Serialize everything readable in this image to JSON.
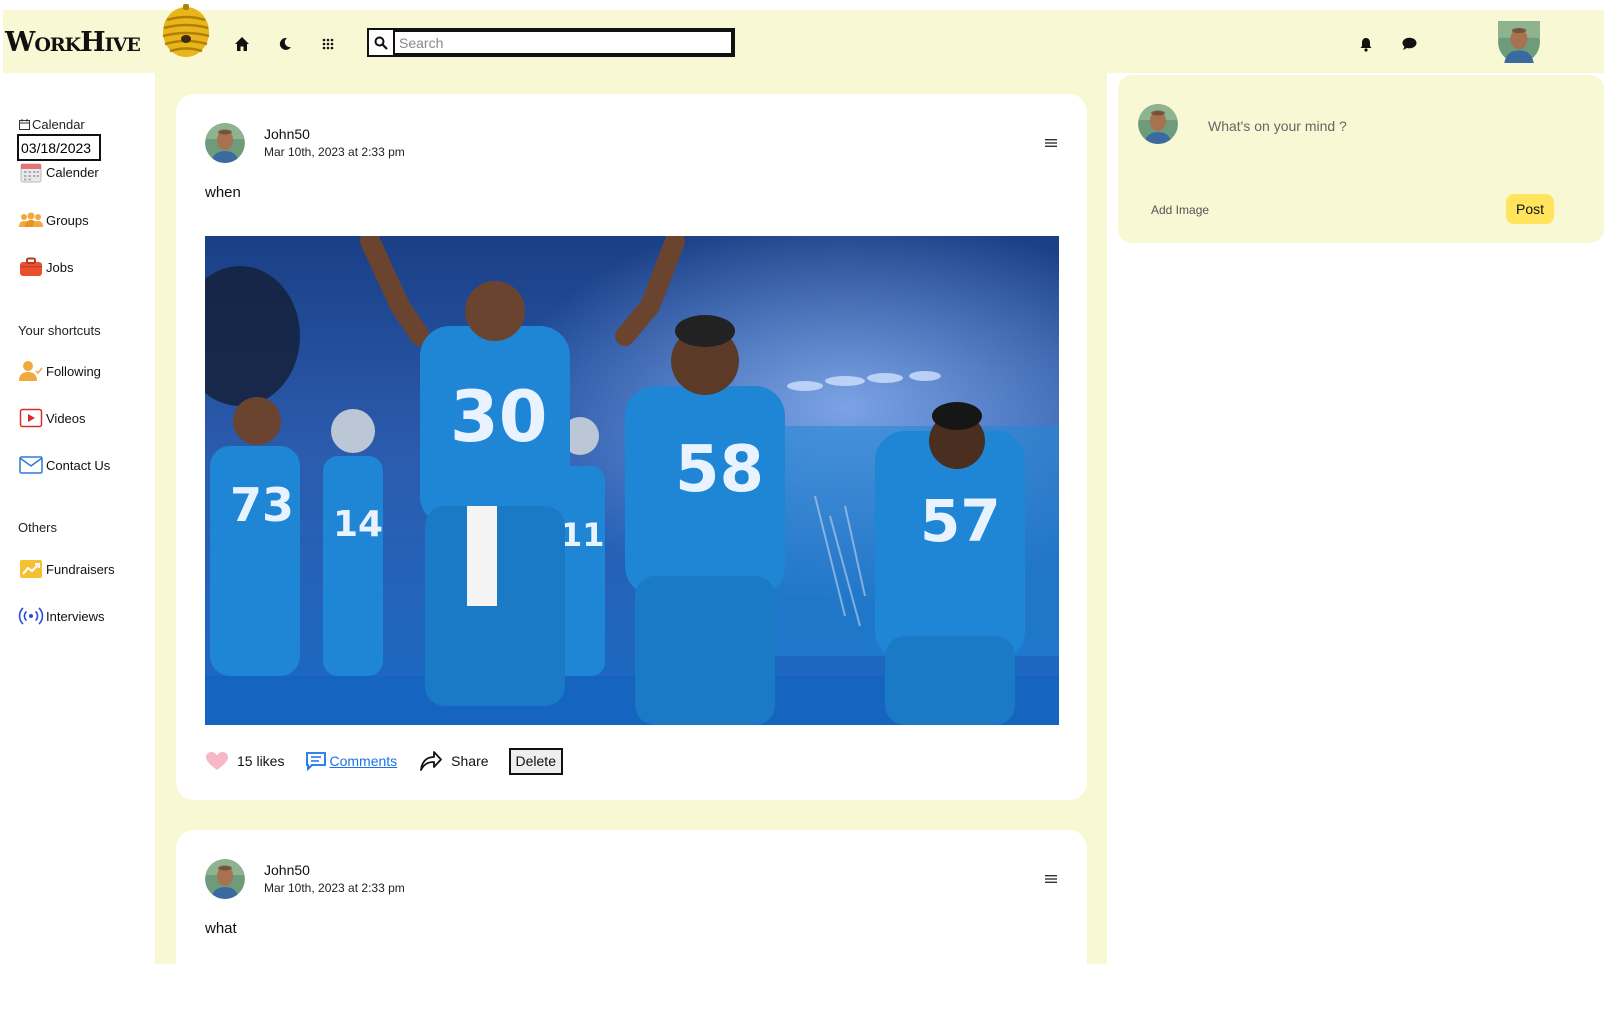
{
  "app": {
    "name": "WorkHive"
  },
  "header": {
    "search_placeholder": "Search"
  },
  "sidebar": {
    "calendar_label": "Calendar",
    "date_value": "03/18/2023",
    "items": [
      {
        "label": "Calender",
        "icon": "calendar-icon"
      },
      {
        "label": "Groups",
        "icon": "groups-icon"
      },
      {
        "label": "Jobs",
        "icon": "briefcase-icon"
      }
    ],
    "shortcuts_heading": "Your shortcuts",
    "shortcuts": [
      {
        "label": "Following",
        "icon": "following-icon"
      },
      {
        "label": "Videos",
        "icon": "video-icon"
      },
      {
        "label": "Contact Us",
        "icon": "mail-icon"
      }
    ],
    "others_heading": "Others",
    "others": [
      {
        "label": "Fundraisers",
        "icon": "trend-icon"
      },
      {
        "label": "Interviews",
        "icon": "broadcast-icon"
      }
    ]
  },
  "posts": [
    {
      "author": "John50",
      "timestamp": "Mar 10th, 2023 at 2:33 pm",
      "text": "when",
      "likes": "15 likes",
      "comments": "Comments",
      "share": "Share",
      "delete": "Delete",
      "jersey_numbers": [
        "30",
        "58",
        "57",
        "73",
        "14",
        "11"
      ]
    },
    {
      "author": "John50",
      "timestamp": "Mar 10th, 2023 at 2:33 pm",
      "text": "what"
    }
  ],
  "composer": {
    "placeholder": "What's on your mind ?",
    "add_image": "Add Image",
    "post_button": "Post"
  },
  "colors": {
    "panel": "#f8f8d5",
    "accent_yellow": "#ffe45c",
    "link_blue": "#1a73e8",
    "jersey_blue": "#1f86d6"
  }
}
